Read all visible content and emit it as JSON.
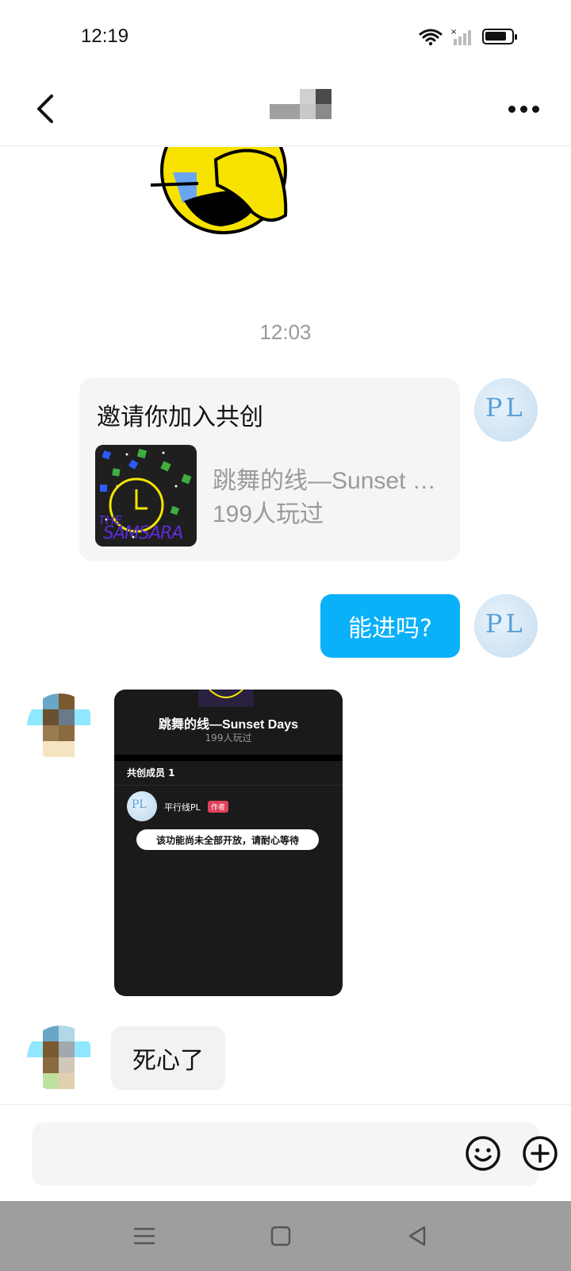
{
  "status_bar": {
    "time": "12:19"
  },
  "header": {
    "back_icon": "chevron-left-icon",
    "more_icon": "more-icon"
  },
  "chat": {
    "timestamp": "12:03",
    "invite_card": {
      "title": "邀请你加入共创",
      "game_name": "跳舞的线—Sunset Days",
      "play_count": "199人玩过",
      "thumb_text": "THE SAMSARA"
    },
    "my_message": "能进吗?",
    "my_avatar_text": "PL",
    "screenshot": {
      "game_title": "跳舞的线—Sunset Days",
      "play_count": "199人玩过",
      "members_label": "共创成员 1",
      "member_name": "平行线PL",
      "member_badge": "作者",
      "member_avatar_text": "PL",
      "toast": "该功能尚未全部开放，请耐心等待"
    },
    "other_message": "死心了"
  },
  "input": {
    "emoji_icon": "emoji-icon",
    "plus_icon": "plus-circle-icon"
  },
  "colors": {
    "accent_blue": "#0ab1f9",
    "bubble_gray": "#f2f2f2",
    "badge_red": "#e0405a"
  }
}
